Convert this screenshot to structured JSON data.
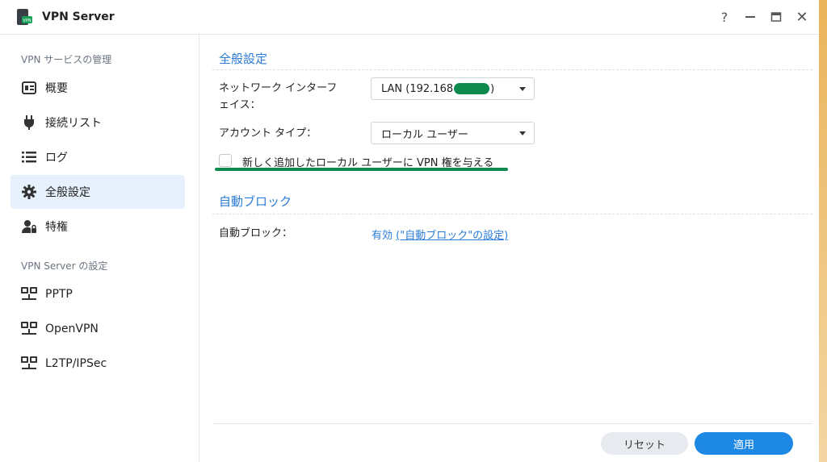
{
  "window": {
    "title": "VPN Server",
    "help_label": "?",
    "close_label": "✕"
  },
  "sidebar": {
    "sections": [
      {
        "label": "VPN サービスの管理",
        "items": [
          {
            "label": "概要",
            "icon": "overview-icon"
          },
          {
            "label": "接続リスト",
            "icon": "plug-icon"
          },
          {
            "label": "ログ",
            "icon": "list-icon"
          },
          {
            "label": "全般設定",
            "icon": "gear-icon",
            "active": true
          },
          {
            "label": "特権",
            "icon": "user-lock-icon"
          }
        ]
      },
      {
        "label": "VPN Server の設定",
        "items": [
          {
            "label": "PPTP",
            "icon": "network-icon"
          },
          {
            "label": "OpenVPN",
            "icon": "network-icon"
          },
          {
            "label": "L2TP/IPSec",
            "icon": "network-icon"
          }
        ]
      }
    ]
  },
  "general": {
    "title": "全般設定",
    "network_interface_label": "ネットワーク インターフェイス：",
    "network_interface_line1": "ネットワーク インターフ",
    "network_interface_line2": "ェイス：",
    "network_interface_value_prefix": "LAN (192.168",
    "network_interface_value_suffix": ")",
    "account_type_label": "アカウント タイプ：",
    "account_type_value": "ローカル ユーザー",
    "grant_vpn_label": "新しく追加したローカル ユーザーに VPN 権を与える",
    "grant_vpn_checked": false
  },
  "autoblock": {
    "title": "自動ブロック",
    "label": "自動ブロック：",
    "status": "有効",
    "link_text": "(\"自動ブロック\"の設定)"
  },
  "footer": {
    "reset_label": "リセット",
    "apply_label": "適用"
  },
  "colors": {
    "accent": "#2a7bd6",
    "apply_button": "#1e88e5",
    "highlight_mark": "#0e8a4f",
    "active_nav_bg": "#e6f1fd"
  }
}
